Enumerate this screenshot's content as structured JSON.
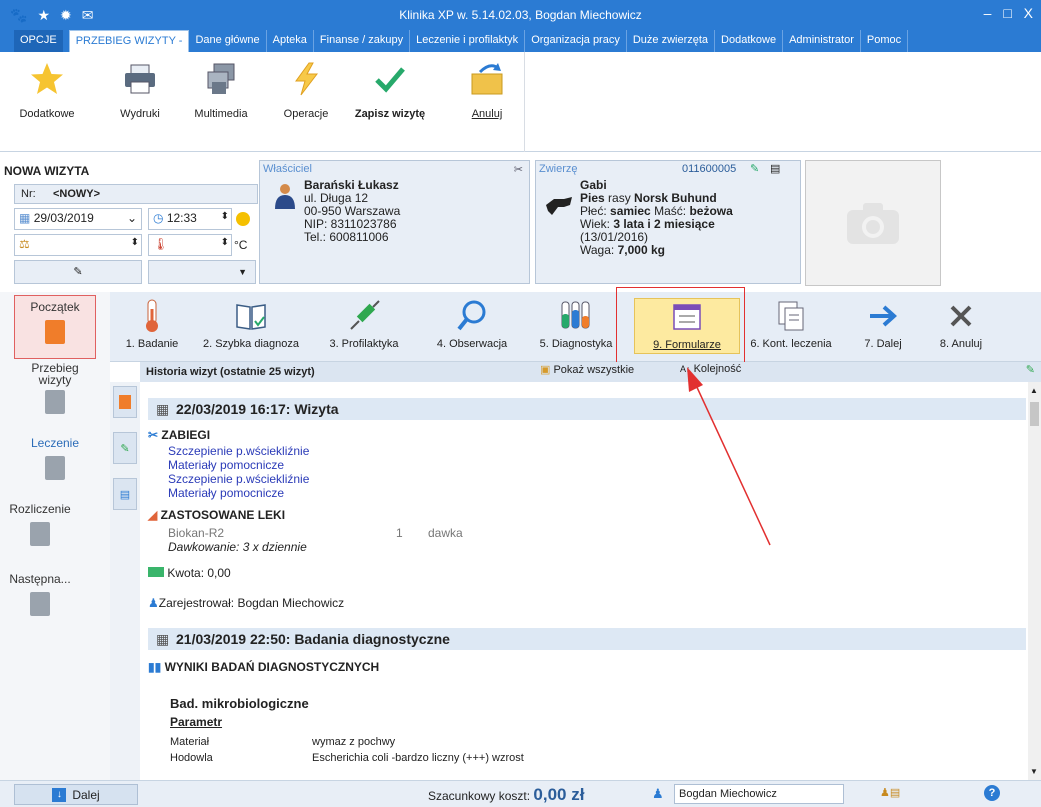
{
  "window": {
    "title": "Klinika XP w. 5.14.02.03, Bogdan Miechowicz",
    "controls": "– □ X"
  },
  "tabs": [
    "OPCJE",
    "PRZEBIEG WIZYTY -",
    "Dane główne",
    "Apteka",
    "Finanse / zakupy",
    "Leczenie i profilaktyk",
    "Organizacja pracy",
    "Duże zwierzęta",
    "Dodatkowe",
    "Administrator",
    "Pomoc"
  ],
  "ribbon": {
    "dodatkowe": "Dodatkowe",
    "wydruki": "Wydruki",
    "multimedia": "Multimedia",
    "operacje": "Operacje",
    "zapisz": "Zapisz wizytę",
    "anuluj": "Anuluj"
  },
  "visit": {
    "title": "NOWA WIZYTA",
    "nr_label": "Nr:",
    "nr_value": "<NOWY>",
    "date": "29/03/2019",
    "time": "12:33",
    "temp_unit": "°C"
  },
  "owner": {
    "header": "Właściciel",
    "name": "Barański Łukasz",
    "street": "ul. Długa 12",
    "city": "00-950  Warszawa",
    "nip": "NIP: 8311023786",
    "tel": "Tel.: 600811006"
  },
  "animal": {
    "header": "Zwierzę",
    "id": "011600005",
    "name": "Gabi",
    "species_prefix": "Pies",
    "breed_prefix": "rasy",
    "breed": "Norsk Buhund",
    "sex_label": "Płeć:",
    "sex": "samiec",
    "color_label": "Maść:",
    "color": "beżowa",
    "age_label": "Wiek:",
    "age": "3 lata i 2 miesiące",
    "birth": "(13/01/2016)",
    "weight_label": "Waga:",
    "weight": "7,000 kg"
  },
  "leftnav": [
    "Początek",
    "Przebieg wizyty",
    "Leczenie",
    "Rozliczenie",
    "Następna..."
  ],
  "toolbar2": [
    "1. Badanie",
    "2. Szybka diagnoza",
    "3. Profilaktyka",
    "4. Obserwacja",
    "5. Diagnostyka",
    "9. Formularze",
    "6. Kont. leczenia",
    "7. Dalej",
    "8. Anuluj"
  ],
  "history": {
    "title": "Historia wizyt (ostatnie 25 wizyt)",
    "show_all": "Pokaż wszystkie",
    "order": "Kolejność"
  },
  "visit1": {
    "header": "22/03/2019 16:17: Wizyta",
    "zabiegi": "ZABIEGI",
    "procedures": [
      "Szczepienie p.wściekliźnie",
      "Materiały pomocnicze",
      "Szczepienie p.wściekliźnie",
      "Materiały pomocnicze"
    ],
    "leki": "ZASTOSOWANE LEKI",
    "drug": "Biokan-R2",
    "qty": "1",
    "unit": "dawka",
    "dosage": "Dawkowanie: 3 x dziennie",
    "amount": "Kwota: 0,00",
    "registered": "Zarejestrował: Bogdan Miechowicz"
  },
  "visit2": {
    "header": "21/03/2019 22:50: Badania diagnostyczne",
    "results": "WYNIKI BADAŃ DIAGNOSTYCZNYCH",
    "group": "Bad. mikrobiologiczne",
    "param_header": "Parametr",
    "rows": [
      {
        "param": "Materiał",
        "value": "wymaz z pochwy"
      },
      {
        "param": "Hodowla",
        "value": "Escherichia coli -bardzo liczny (+++) wzrost"
      }
    ]
  },
  "status": {
    "dalej": "Dalej",
    "cost_label": "Szacunkowy koszt:",
    "cost": "0,00 zł",
    "user": "Bogdan Miechowicz"
  },
  "colors": {
    "accent": "#2b7bd3",
    "highlight": "#fdeaa0",
    "annotation": "#e23030"
  }
}
